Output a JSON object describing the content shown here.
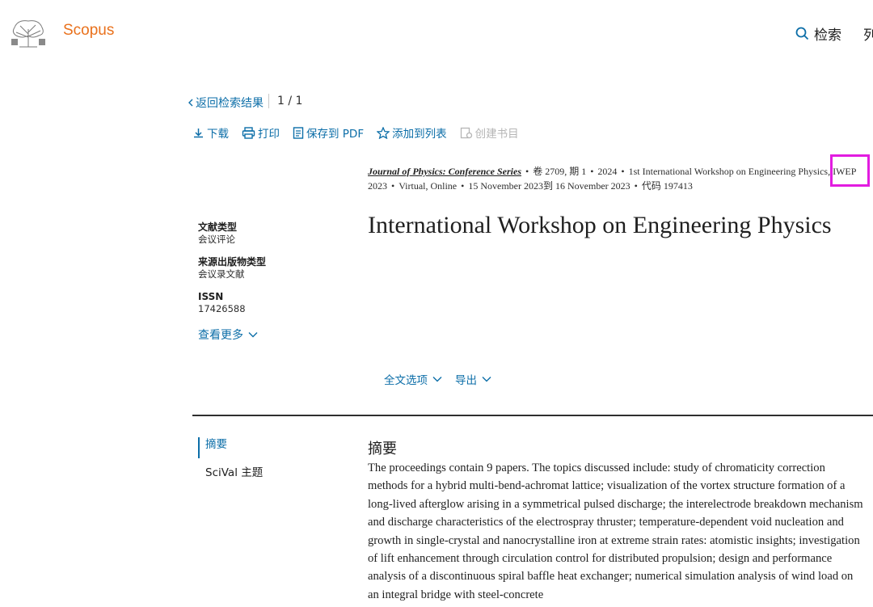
{
  "header": {
    "logo_text": "Scopus",
    "search_label": "检索",
    "more_label": "列"
  },
  "nav": {
    "back_label": "返回检索结果",
    "pager": "1 / 1"
  },
  "toolbar": {
    "download": "下载",
    "print": "打印",
    "save_pdf": "保存到 PDF",
    "add_list": "添加到列表",
    "create_bib": "创建书目"
  },
  "source": {
    "journal": "Journal of Physics: Conference Series",
    "volume": "卷 2709, 期 1",
    "year": "2024",
    "conference": "1st International Workshop on Engineering Physics, IWEP 2023",
    "location": "Virtual, Online",
    "dates": "15 November 2023到 16 November 2023",
    "code": "代码 197413"
  },
  "document": {
    "title": "International Workshop on Engineering Physics"
  },
  "meta": {
    "doc_type_label": "文献类型",
    "doc_type_value": "会议评论",
    "source_type_label": "来源出版物类型",
    "source_type_value": "会议录文献",
    "issn_label": "ISSN",
    "issn_value": "17426588",
    "see_more": "查看更多"
  },
  "options": {
    "full_text": "全文选项",
    "export": "导出"
  },
  "side_nav": {
    "abstract": "摘要",
    "scival": "SciVal 主题"
  },
  "abstract": {
    "heading": "摘要",
    "body": "The proceedings contain 9 papers. The topics discussed include: study of chromaticity correction methods for a hybrid multi-bend-achromat lattice; visualization of the vortex structure formation of a long-lived afterglow arising in a symmetrical pulsed discharge; the interelectrode breakdown mechanism and discharge characteristics of the electrospray thruster; temperature-dependent void nucleation and growth in single-crystal and nanocrystalline iron at extreme strain rates: atomistic insights; investigation of lift enhancement through circulation control for distributed propulsion; design and performance analysis of a discontinuous spiral baffle heat exchanger; numerical simulation analysis of wind load on an integral bridge with steel-concrete"
  },
  "colors": {
    "link": "#0c6ea8",
    "brand": "#e9711c",
    "highlight": "#e21ce0"
  },
  "icons": [
    "elsevier-tree-icon",
    "search-icon",
    "chevron-left-icon",
    "download-icon",
    "print-icon",
    "pdf-icon",
    "star-icon",
    "bibliography-icon",
    "chevron-down-icon"
  ]
}
